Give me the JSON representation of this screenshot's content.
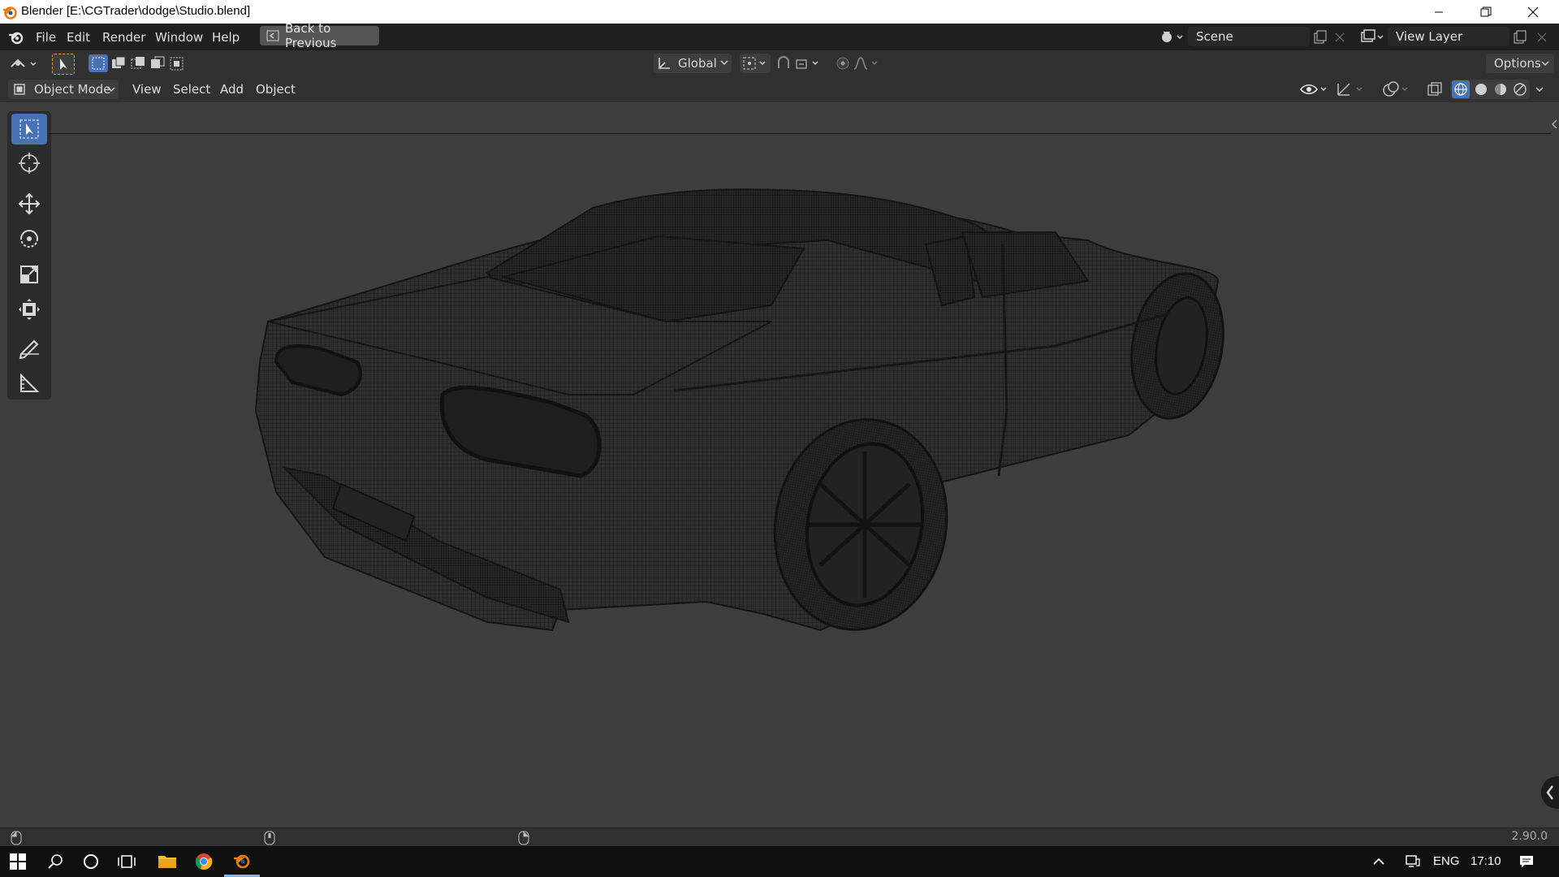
{
  "window": {
    "title": "Blender [E:\\CGTrader\\dodge\\Studio.blend]",
    "controls": [
      "minimize",
      "restore",
      "close"
    ]
  },
  "menubar": {
    "items": [
      "File",
      "Edit",
      "Render",
      "Window",
      "Help"
    ],
    "back_button": "Back to Previous",
    "scene_field": "Scene",
    "view_layer_field": "View Layer"
  },
  "tool_header": {
    "transform_orientation": "Global",
    "options_label": "Options"
  },
  "viewport_header": {
    "mode": "Object Mode",
    "menus": [
      "View",
      "Select",
      "Add",
      "Object"
    ]
  },
  "toolbar": {
    "tools": [
      "select-box",
      "cursor",
      "move",
      "rotate",
      "scale",
      "transform",
      "annotate",
      "measure"
    ],
    "active": "select-box"
  },
  "status": {
    "version": "2.90.0"
  },
  "taskbar": {
    "language": "ENG",
    "time": "17:10",
    "pinned": [
      "start",
      "search",
      "cortana",
      "task-view",
      "file-explorer",
      "chrome",
      "blender"
    ]
  },
  "colors": {
    "accent": "#4772b3",
    "viewport_bg": "#3d3d3d",
    "header_bg": "#303030",
    "menubar_bg": "#1f1f1f",
    "blender_orange": "#e87d0d"
  }
}
